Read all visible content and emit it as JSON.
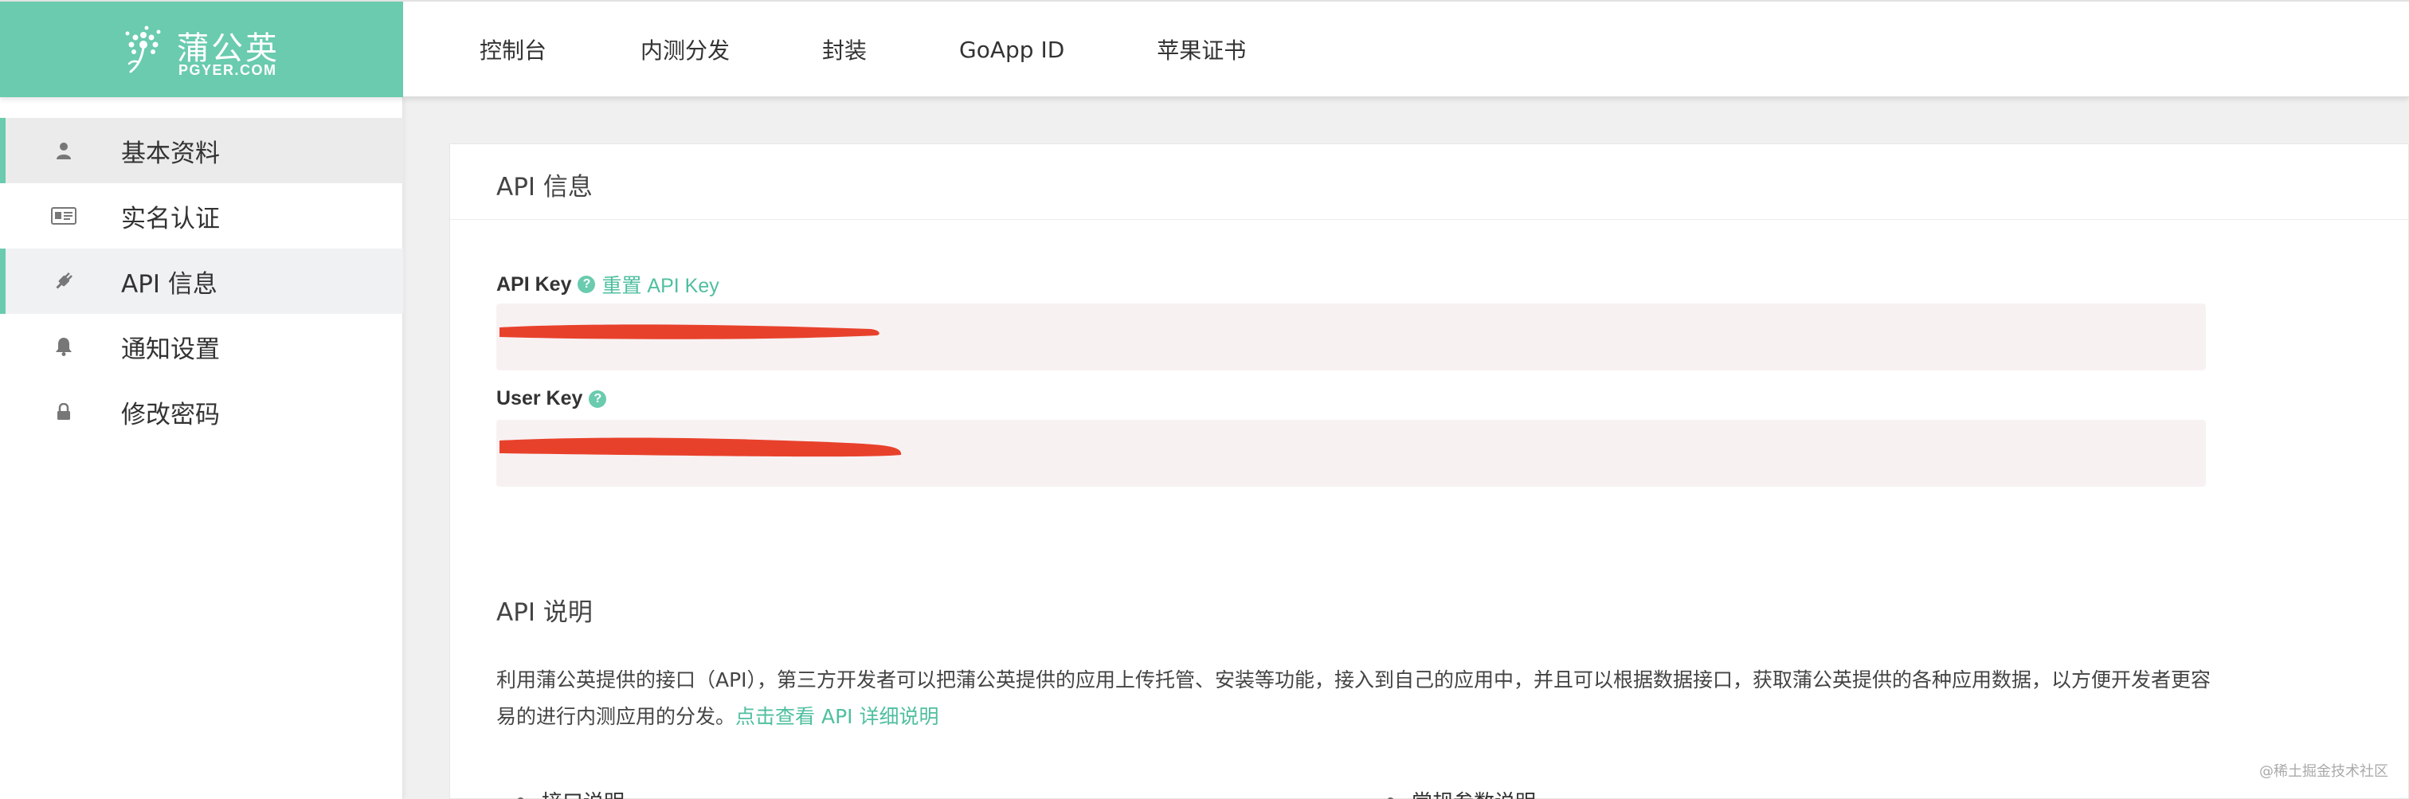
{
  "brand": {
    "name_cn": "蒲公英",
    "name_en": "PGYER.COM",
    "color": "#6acbae"
  },
  "nav": {
    "items": [
      {
        "label": "控制台"
      },
      {
        "label": "内测分发"
      },
      {
        "label": "封装"
      },
      {
        "label": "GoApp ID"
      },
      {
        "label": "苹果证书"
      }
    ]
  },
  "sidebar": {
    "items": [
      {
        "label": "基本资料",
        "icon": "user-icon",
        "state": "active"
      },
      {
        "label": "实名认证",
        "icon": "id-card-icon",
        "state": "normal"
      },
      {
        "label": "API 信息",
        "icon": "plug-icon",
        "state": "hovered"
      },
      {
        "label": "通知设置",
        "icon": "bell-icon",
        "state": "normal"
      },
      {
        "label": "修改密码",
        "icon": "lock-icon",
        "state": "normal"
      }
    ]
  },
  "main": {
    "title": "API 信息",
    "api_key": {
      "label": "API Key",
      "reset_link": "重置 API Key",
      "value": "(redacted)"
    },
    "user_key": {
      "label": "User Key",
      "value": "(redacted)"
    },
    "explain": {
      "title": "API 说明",
      "description": "利用蒲公英提供的接口（API），第三方开发者可以把蒲公英提供的应用上传托管、安装等功能，接入到自己的应用中，并且可以根据数据接口，获取蒲公英提供的各种应用数据，以方便开发者更容易的进行内测应用的分发。",
      "link": "点击查看 API 详细说明",
      "bullets": [
        "接口说明",
        "常规参数说明"
      ]
    }
  },
  "watermark": "@稀土掘金技术社区",
  "colors": {
    "accent": "#6acbae",
    "redaction": "#e8412b",
    "key_box_bg": "#f8f1f2"
  }
}
